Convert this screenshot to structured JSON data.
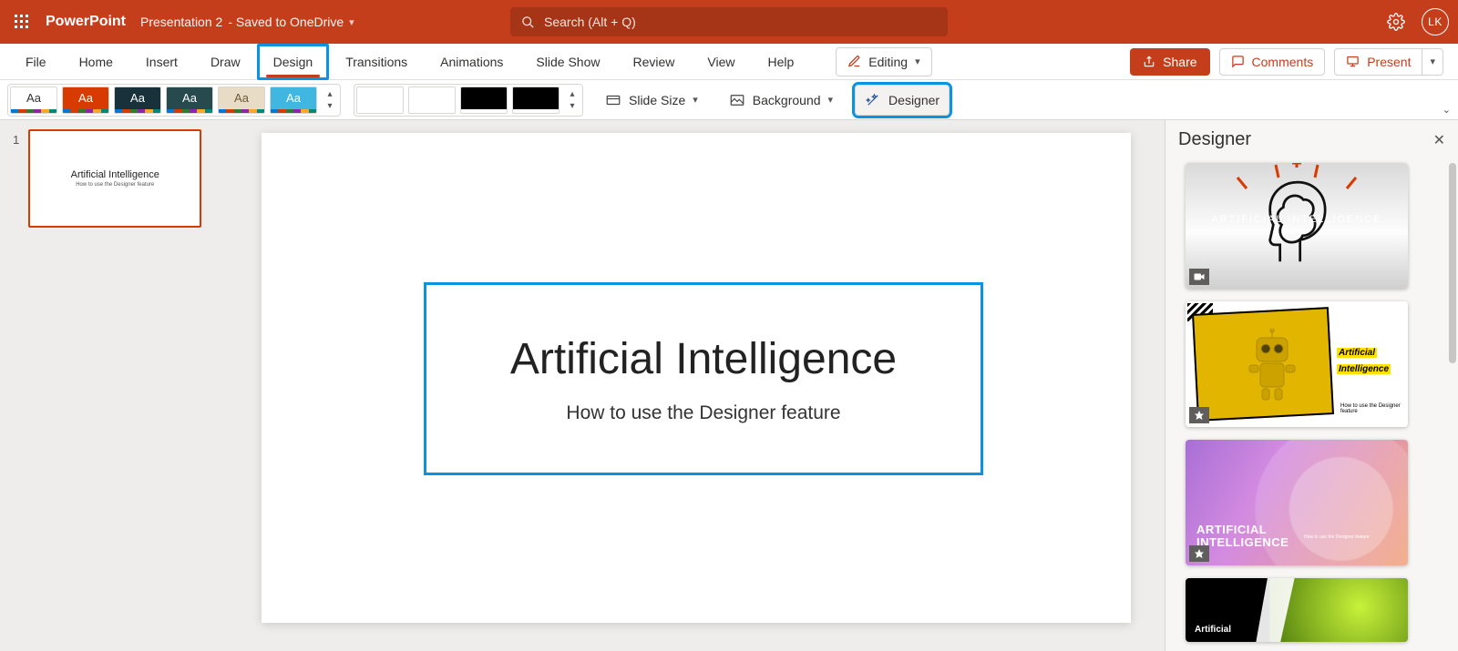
{
  "titlebar": {
    "app_name": "PowerPoint",
    "document_title": "Presentation 2",
    "save_status": "- Saved to OneDrive",
    "search_placeholder": "Search (Alt + Q)",
    "avatar_initials": "LK"
  },
  "tabs": {
    "items": [
      "File",
      "Home",
      "Insert",
      "Draw",
      "Design",
      "Transitions",
      "Animations",
      "Slide Show",
      "Review",
      "View",
      "Help"
    ],
    "active": "Design"
  },
  "tabs_right": {
    "editing_label": "Editing",
    "share_label": "Share",
    "comments_label": "Comments",
    "present_label": "Present"
  },
  "ribbon": {
    "slide_size_label": "Slide Size",
    "background_label": "Background",
    "designer_label": "Designer",
    "theme_letters": "Aa"
  },
  "thumbnails": {
    "items": [
      {
        "index": "1",
        "title": "Artificial Intelligence",
        "subtitle": "How to use the Designer feature"
      }
    ]
  },
  "slide": {
    "title": "Artificial Intelligence",
    "subtitle": "How to use the Designer feature"
  },
  "designer_pane": {
    "title": "Designer",
    "idea1_label": "ARTIFICIAL INTELLIGENCE",
    "idea2_title_line1": "Artificial",
    "idea2_title_line2": "Intelligence",
    "idea2_sub": "How to use the Designer feature",
    "idea3_title_line1": "ARTIFICIAL",
    "idea3_title_line2": "INTELLIGENCE",
    "idea3_sub": "How to use the Designer feature",
    "idea4_title": "Artificial"
  }
}
